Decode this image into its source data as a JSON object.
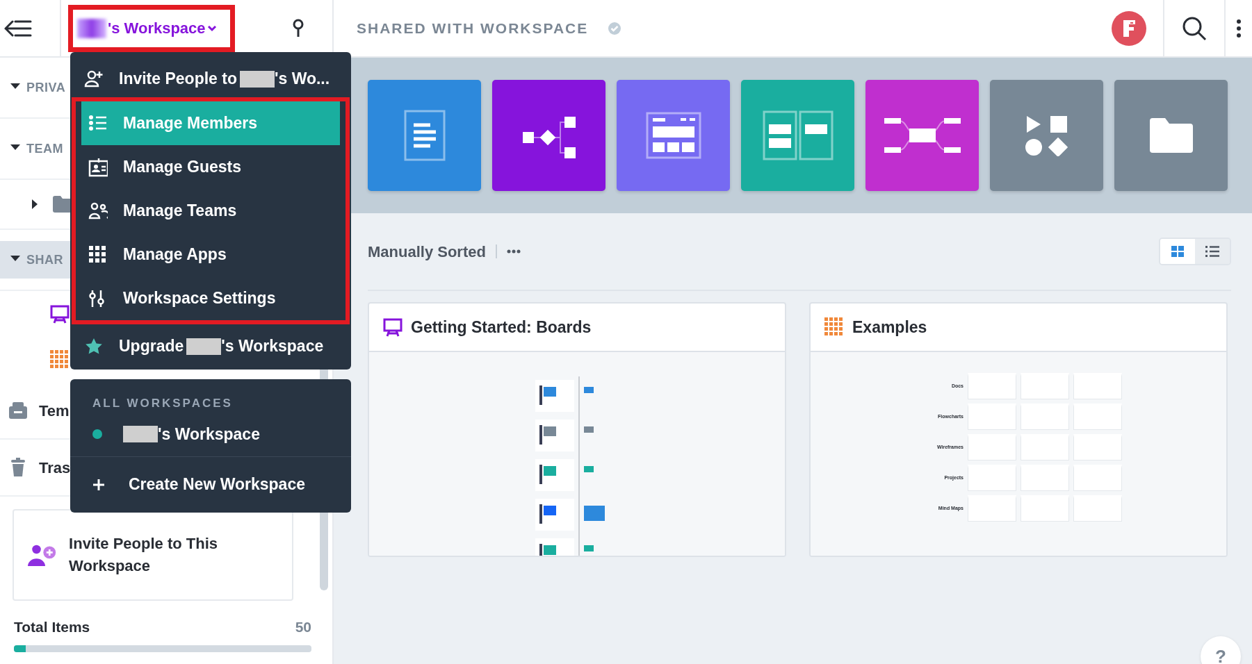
{
  "sidebar": {
    "workspace_button": {
      "label_after": "'s Workspace",
      "highlighted": true
    },
    "items": [
      {
        "kind": "section",
        "label": "PRIVA",
        "expanded": true,
        "selected": false
      },
      {
        "kind": "section",
        "label": "TEAM",
        "expanded": true,
        "selected": false
      },
      {
        "kind": "folder",
        "expanded": false
      },
      {
        "kind": "section",
        "label": "SHAR",
        "expanded": true,
        "selected": true
      },
      {
        "kind": "board"
      },
      {
        "kind": "grid"
      },
      {
        "kind": "templates",
        "label": "Tem"
      },
      {
        "kind": "trash",
        "label": "Tras"
      }
    ],
    "invite_card": {
      "text": "Invite People to This Workspace"
    },
    "total": {
      "label": "Total Items",
      "value": "50",
      "level": 0.04
    }
  },
  "workspace_menu": {
    "groups": [
      {
        "framed": false,
        "items": [
          {
            "kind": "invite",
            "label": "Invite People to",
            "label_after": "'s Wo...",
            "selected": false
          }
        ]
      },
      {
        "framed": true,
        "items": [
          {
            "kind": "members",
            "label": "Manage Members",
            "selected": true
          },
          {
            "kind": "guests",
            "label": "Manage Guests",
            "selected": false
          },
          {
            "kind": "teams",
            "label": "Manage Teams",
            "selected": false
          },
          {
            "kind": "apps",
            "label": "Manage Apps",
            "selected": false
          },
          {
            "kind": "settings",
            "label": "Workspace Settings",
            "selected": false
          }
        ]
      },
      {
        "framed": false,
        "items": [
          {
            "kind": "upgrade",
            "label": "Upgrade",
            "label_after": "'s Workspace",
            "selected": false
          }
        ]
      }
    ]
  },
  "workspaces_menu": {
    "header": "ALL WORKSPACES",
    "items": [
      {
        "label_after": "'s Workspace",
        "selected": true
      }
    ],
    "create": "Create New Workspace"
  },
  "header": {
    "title": "SHARED WITH WORKSPACE"
  },
  "templates": [
    {
      "kind": "doc",
      "color": "#2d89dc"
    },
    {
      "kind": "flowchart",
      "color": "#8614dc"
    },
    {
      "kind": "wireframe",
      "color": "#766af2"
    },
    {
      "kind": "project",
      "color": "#1aae9f"
    },
    {
      "kind": "mindmap",
      "color": "#c02fcf"
    },
    {
      "kind": "shapes",
      "color": "#788896"
    },
    {
      "kind": "folder",
      "color": "#788896"
    }
  ],
  "toolbar": {
    "sort_label": "Manually Sorted",
    "views": [
      {
        "kind": "grid",
        "selected": true
      },
      {
        "kind": "list",
        "selected": false
      }
    ]
  },
  "cards": [
    {
      "kind": "board",
      "title": "Getting Started: Boards"
    },
    {
      "kind": "examples",
      "title": "Examples",
      "row_labels": [
        "Docs",
        "Flowcharts",
        "Wireframes",
        "Projects",
        "Mind Maps"
      ]
    }
  ],
  "help": "?"
}
